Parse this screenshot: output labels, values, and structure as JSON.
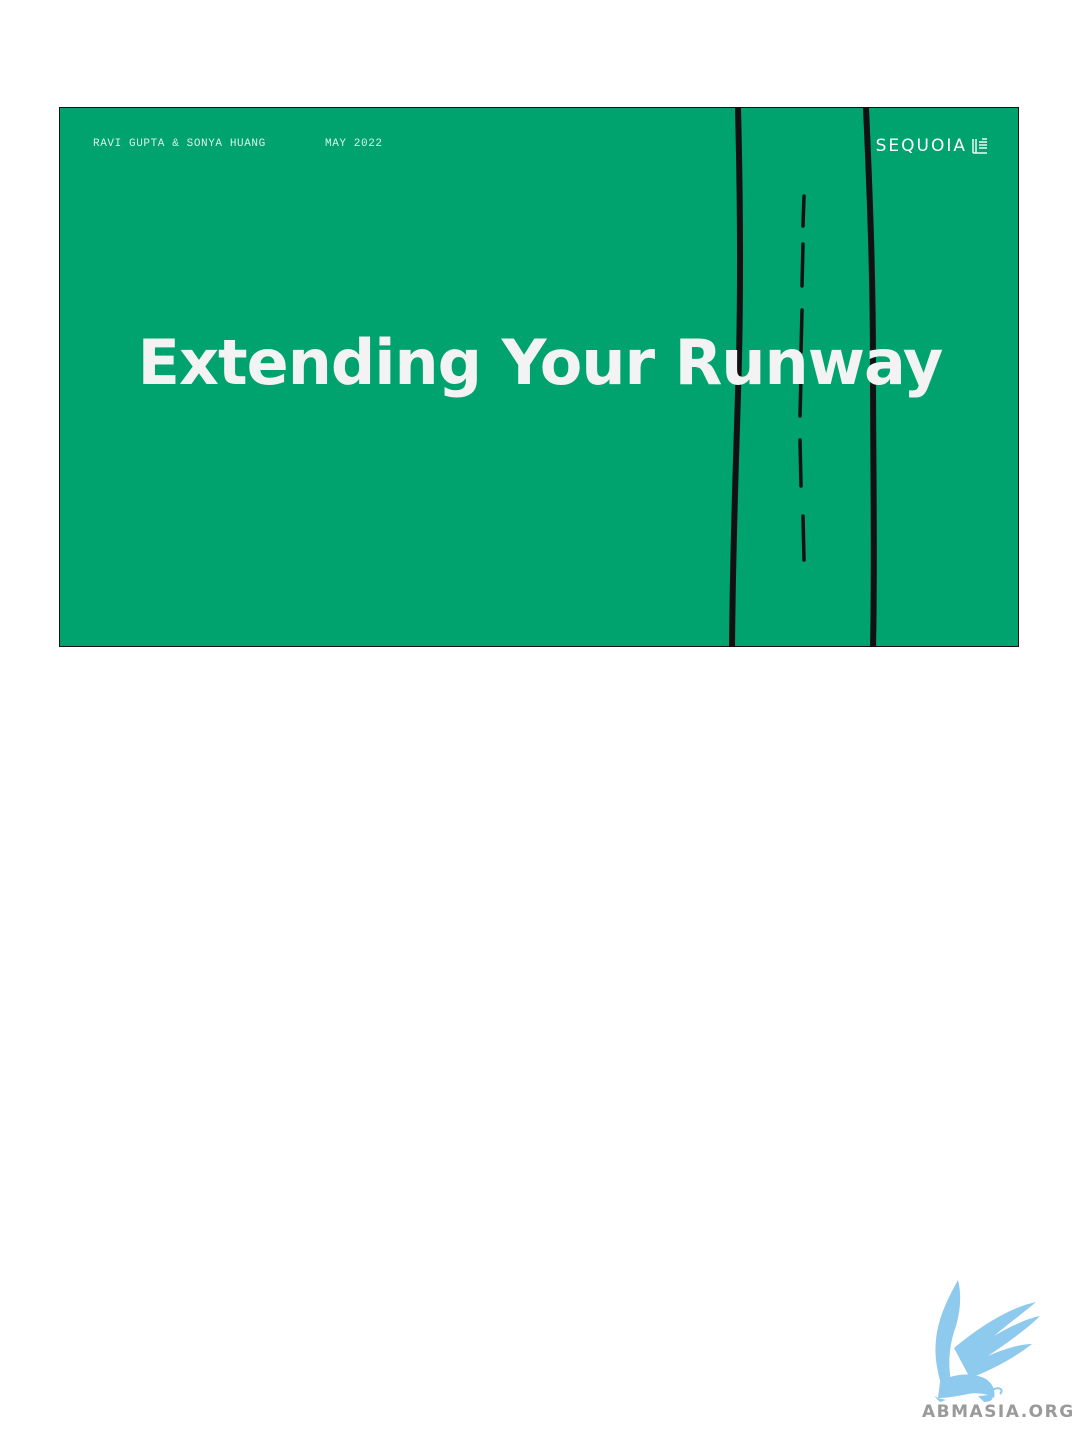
{
  "slide": {
    "authors": "RAVI GUPTA & SONYA HUANG",
    "date": "MAY 2022",
    "brand": "SEQUOIA",
    "title": "Extending Your Runway",
    "background_color": "#00a26e"
  },
  "watermark": {
    "text": "ABMASIA.ORG",
    "icon": "griffin-logo-icon"
  }
}
